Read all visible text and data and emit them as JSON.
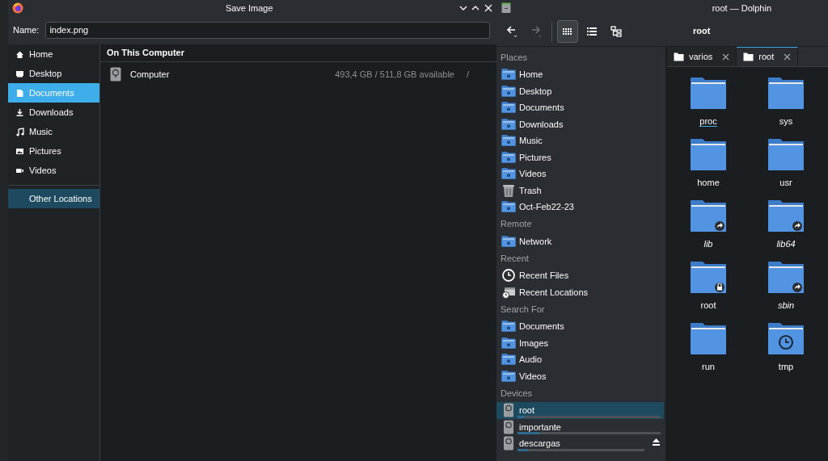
{
  "dialog": {
    "title": "Save Image",
    "name_label": "Name:",
    "name_value": "index.png",
    "sidebar": [
      {
        "label": "Home",
        "kind": "home",
        "selected": false
      },
      {
        "label": "Desktop",
        "kind": "desktop",
        "selected": false
      },
      {
        "label": "Documents",
        "kind": "document",
        "selected": true
      },
      {
        "label": "Downloads",
        "kind": "download",
        "selected": false
      },
      {
        "label": "Music",
        "kind": "music",
        "selected": false
      },
      {
        "label": "Pictures",
        "kind": "picture",
        "selected": false
      },
      {
        "label": "Videos",
        "kind": "video",
        "selected": false
      }
    ],
    "other_locations": [
      {
        "label": "Other Locations",
        "selected": true
      }
    ],
    "section_title": "On This Computer",
    "locations": [
      {
        "name": "Computer",
        "space": "493,4 GB / 511,8 GB available",
        "path": "/"
      }
    ]
  },
  "dolphin": {
    "title": "root — Dolphin",
    "forward_disabled": true,
    "view_modes": [
      {
        "kind": "icons",
        "selected": true
      },
      {
        "kind": "details",
        "selected": false
      },
      {
        "kind": "tree",
        "selected": false
      }
    ],
    "location": "root",
    "places": [
      {
        "title": "Places",
        "items": [
          {
            "label": "Home",
            "kind": "folder",
            "selected": false
          },
          {
            "label": "Desktop",
            "kind": "folder",
            "selected": false
          },
          {
            "label": "Documents",
            "kind": "folder",
            "selected": false
          },
          {
            "label": "Downloads",
            "kind": "folder",
            "selected": false
          },
          {
            "label": "Music",
            "kind": "folder",
            "selected": false
          },
          {
            "label": "Pictures",
            "kind": "folder",
            "selected": false
          },
          {
            "label": "Videos",
            "kind": "folder",
            "selected": false
          },
          {
            "label": "Trash",
            "kind": "trash",
            "selected": false
          },
          {
            "label": "Oct-Feb22-23",
            "kind": "folder",
            "selected": false
          }
        ]
      },
      {
        "title": "Remote",
        "items": [
          {
            "label": "Network",
            "kind": "folder",
            "selected": false
          }
        ]
      },
      {
        "title": "Recent",
        "items": [
          {
            "label": "Recent Files",
            "kind": "clock",
            "selected": false
          },
          {
            "label": "Recent Locations",
            "kind": "recent",
            "selected": false
          }
        ]
      },
      {
        "title": "Search For",
        "items": [
          {
            "label": "Documents",
            "kind": "folder",
            "selected": false
          },
          {
            "label": "Images",
            "kind": "folder",
            "selected": false
          },
          {
            "label": "Audio",
            "kind": "folder",
            "selected": false
          },
          {
            "label": "Videos",
            "kind": "folder",
            "selected": false
          }
        ]
      },
      {
        "title": "Devices",
        "items": [
          {
            "label": "root",
            "kind": "drive",
            "selected": true,
            "level": 0.05,
            "ejectable": false
          },
          {
            "label": "importante",
            "kind": "drive",
            "selected": false,
            "level": 0.15,
            "ejectable": false
          },
          {
            "label": "descargas",
            "kind": "drive",
            "selected": false,
            "level": 0.08,
            "ejectable": true
          }
        ]
      }
    ],
    "tabs": [
      {
        "label": "varios",
        "selected": false
      },
      {
        "label": "root",
        "selected": true
      }
    ],
    "files": [
      {
        "name": "proc",
        "kind": "folder",
        "focused": true
      },
      {
        "name": "sys",
        "kind": "folder",
        "focused": false
      },
      {
        "name": "home",
        "kind": "folder",
        "focused": false
      },
      {
        "name": "usr",
        "kind": "folder",
        "focused": false
      },
      {
        "name": "lib",
        "kind": "link",
        "focused": false
      },
      {
        "name": "lib64",
        "kind": "link",
        "focused": false
      },
      {
        "name": "root",
        "kind": "lock",
        "focused": false
      },
      {
        "name": "sbin",
        "kind": "link",
        "focused": false
      },
      {
        "name": "run",
        "kind": "folder",
        "focused": false
      },
      {
        "name": "tmp",
        "kind": "clock",
        "focused": false
      }
    ]
  }
}
